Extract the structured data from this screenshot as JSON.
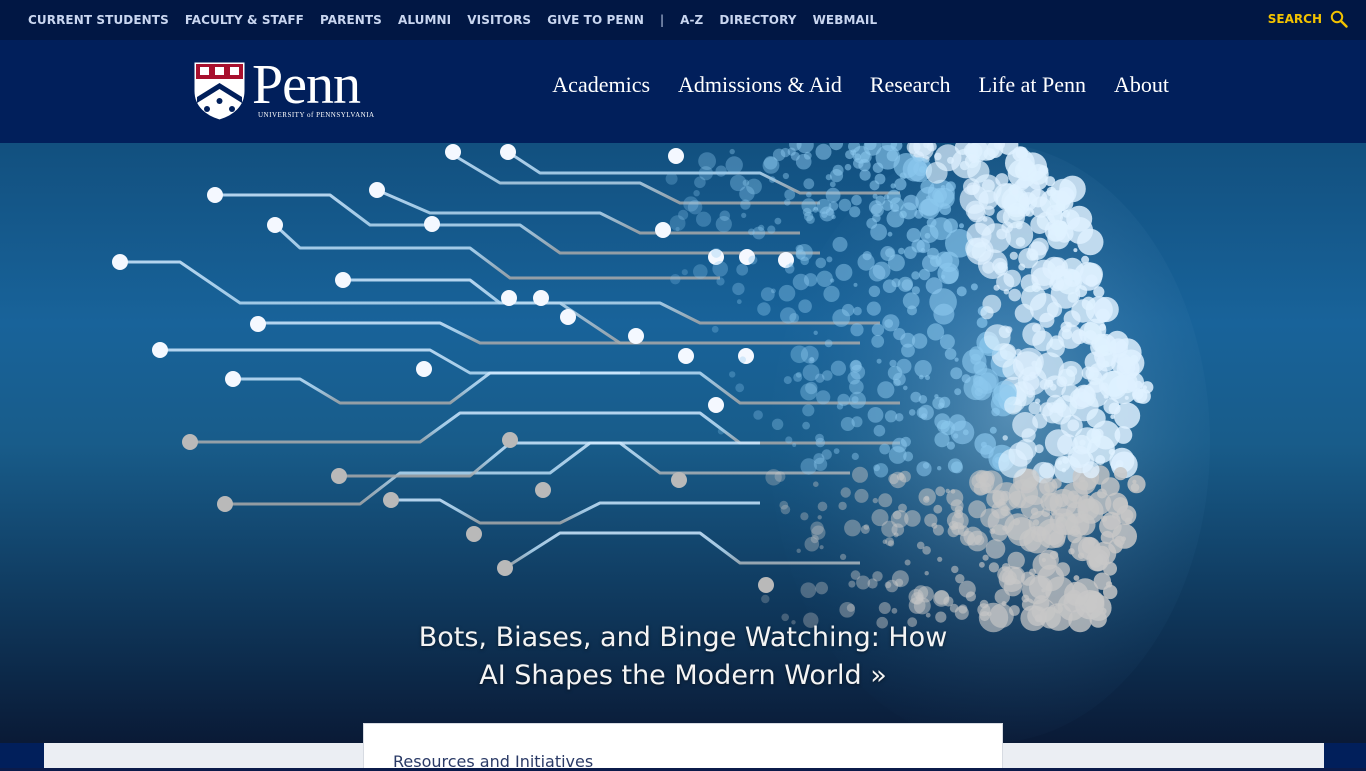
{
  "utility_nav": {
    "links": [
      "CURRENT STUDENTS",
      "FACULTY & STAFF",
      "PARENTS",
      "ALUMNI",
      "VISITORS",
      "GIVE TO PENN"
    ],
    "separator": "|",
    "secondary_links": [
      "A-Z",
      "DIRECTORY",
      "WEBMAIL"
    ],
    "search_label": "SEARCH",
    "search_icon": "search-icon"
  },
  "logo": {
    "name": "Penn",
    "subtitle": "UNIVERSITY of PENNSYLVANIA",
    "shield_icon": "university-shield-icon"
  },
  "main_nav": {
    "items": [
      "Academics",
      "Admissions & Aid",
      "Research",
      "Life at Penn",
      "About"
    ]
  },
  "hero": {
    "caption_line1": "Bots, Biases, and Binge Watching: How",
    "caption_line2": "AI Shapes the Modern World »",
    "image_icon": "ai-circuit-head-illustration"
  },
  "resources": {
    "title": "Resources and Initiatives"
  },
  "colors": {
    "penn_blue": "#011f5b",
    "penn_gold": "#f2c200",
    "hero_blue": "#18639a"
  }
}
